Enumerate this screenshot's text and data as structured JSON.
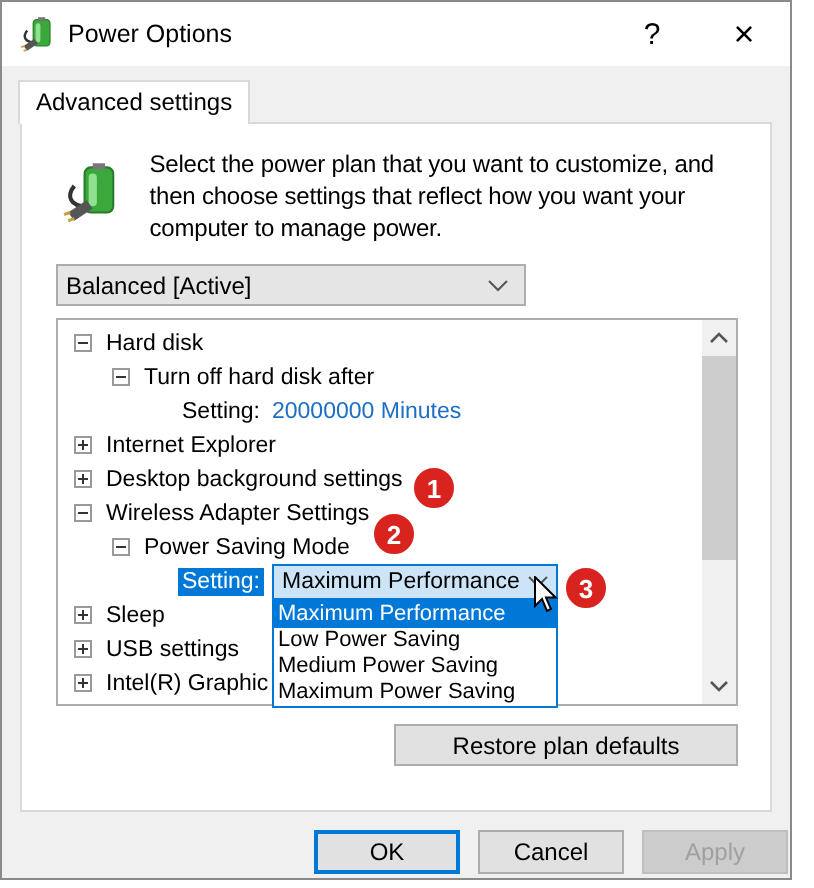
{
  "window": {
    "title": "Power Options",
    "help": "?",
    "close": "×"
  },
  "tabs": [
    {
      "label": "Advanced settings",
      "selected": true
    }
  ],
  "intro": "Select the power plan that you want to customize, and then choose settings that reflect how you want your computer to manage power.",
  "plan_select": {
    "value": "Balanced [Active]"
  },
  "tree": [
    {
      "kind": "group",
      "label": "Hard disk",
      "expanded": true,
      "selected": false,
      "children": [
        {
          "kind": "group",
          "label": "Turn off hard disk after",
          "expanded": true,
          "selected": false,
          "children": [
            {
              "kind": "setting",
              "label": "Setting:",
              "value": "20000000 Minutes",
              "selected": false
            }
          ]
        }
      ]
    },
    {
      "kind": "group",
      "label": "Internet Explorer",
      "expanded": false,
      "selected": false
    },
    {
      "kind": "group",
      "label": "Desktop background settings",
      "expanded": false,
      "selected": false
    },
    {
      "kind": "group",
      "label": "Wireless Adapter Settings",
      "expanded": true,
      "selected": false,
      "children": [
        {
          "kind": "group",
          "label": "Power Saving Mode",
          "expanded": true,
          "selected": false,
          "children": [
            {
              "kind": "setting-combo",
              "label": "Setting:",
              "value": "Maximum Performance",
              "selected": true,
              "options": [
                {
                  "label": "Maximum Performance",
                  "selected": true
                },
                {
                  "label": "Low Power Saving",
                  "selected": false
                },
                {
                  "label": "Medium Power Saving",
                  "selected": false
                },
                {
                  "label": "Maximum Power Saving",
                  "selected": false
                }
              ]
            }
          ]
        }
      ]
    },
    {
      "kind": "group",
      "label": "Sleep",
      "expanded": false,
      "selected": false
    },
    {
      "kind": "group",
      "label": "USB settings",
      "expanded": false,
      "selected": false
    },
    {
      "kind": "group",
      "label": "Intel(R) Graphic",
      "expanded": false,
      "selected": false
    }
  ],
  "callouts": [
    "1",
    "2",
    "3"
  ],
  "restore_button": "Restore plan defaults",
  "buttons": [
    {
      "label": "OK",
      "disabled": false,
      "default": true
    },
    {
      "label": "Cancel",
      "disabled": false,
      "default": false
    },
    {
      "label": "Apply",
      "disabled": true,
      "default": false
    }
  ]
}
